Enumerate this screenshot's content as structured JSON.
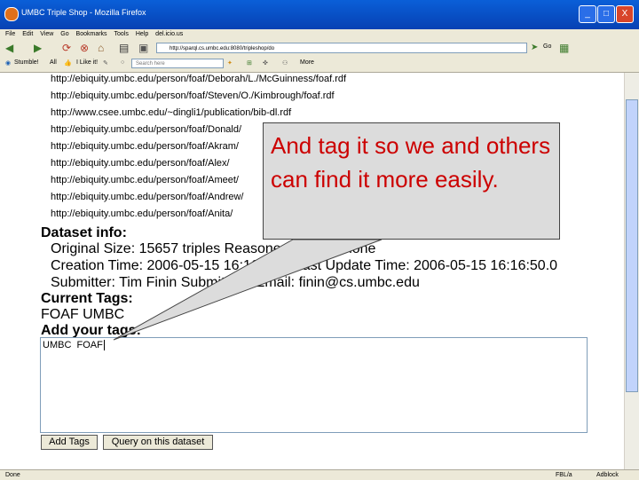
{
  "window": {
    "title": "UMBC Triple Shop - Mozilla Firefox",
    "min_glyph": "_",
    "max_glyph": "□",
    "close_glyph": "X"
  },
  "menubar": {
    "items": [
      "File",
      "Edit",
      "View",
      "Go",
      "Bookmarks",
      "Tools",
      "Help",
      "del.icio.us"
    ]
  },
  "navbar": {
    "url": "http://sparql.cs.umbc.edu:8080/tripleshop/do",
    "go_label": "Go"
  },
  "toolbar": {
    "stumble_label": "Stumble!",
    "all_label": "All",
    "rate_label": "I Like it!",
    "search_placeholder": "Search here",
    "more_label": "More"
  },
  "content": {
    "urls": [
      "http://ebiquity.umbc.edu/person/foaf/Deborah/L./McGuinness/foaf.rdf",
      "http://ebiquity.umbc.edu/person/foaf/Steven/O./Kimbrough/foaf.rdf",
      "http://www.csee.umbc.edu/~dingli1/publication/bib-dl.rdf",
      "http://ebiquity.umbc.edu/person/foaf/Donald/",
      "http://ebiquity.umbc.edu/person/foaf/Akram/",
      "http://ebiquity.umbc.edu/person/foaf/Alex/",
      "http://ebiquity.umbc.edu/person/foaf/Ameet/",
      "http://ebiquity.umbc.edu/person/foaf/Andrew/",
      "http://ebiquity.umbc.edu/person/foaf/Anita/"
    ],
    "dataset_info_label": "Dataset info:",
    "line1": "Original Size: 15657 triples   Reasoner Applied: none",
    "line2": "Creation Time: 2006-05-15 16:16:50.0   Last Update Time: 2006-05-15 16:16:50.0",
    "line3": "Submitter: Tim Finin   Submitter's Email: finin@cs.umbc.edu",
    "current_tags_label": "Current Tags:",
    "current_tags": "FOAF UMBC",
    "add_tags_label": "Add your tags:",
    "tag_input_value": "UMBC  FOAF",
    "add_tags_button": "Add Tags",
    "query_button": "Query on this dataset"
  },
  "callout": {
    "text": "And tag it so we and others can find it more easily."
  },
  "statusbar": {
    "left": "Done",
    "zone1": "FBL/a",
    "zone2": "Adblock"
  }
}
